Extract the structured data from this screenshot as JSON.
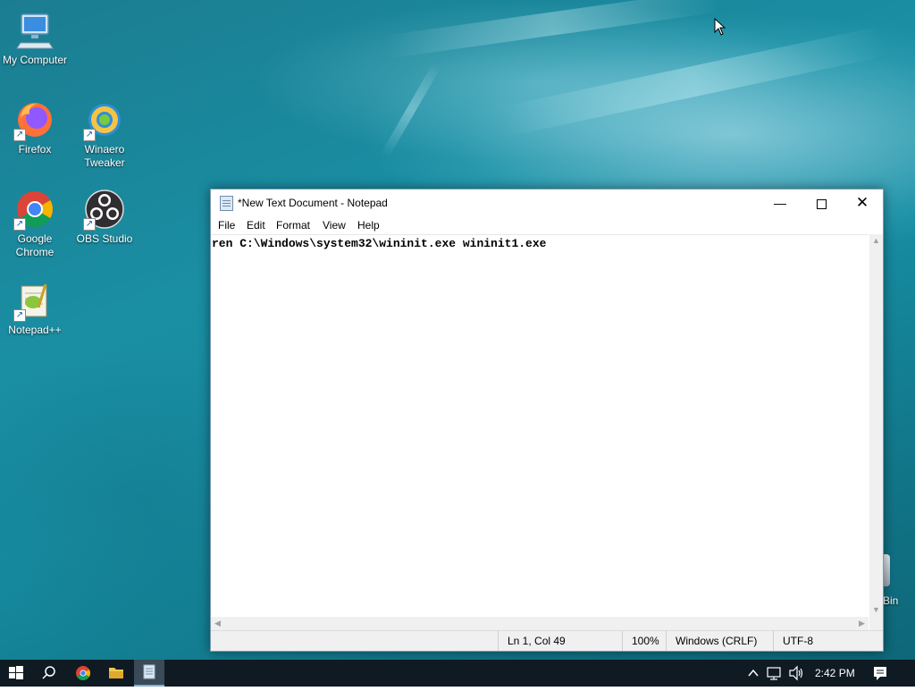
{
  "desktop": {
    "icons": [
      {
        "label": "My Computer",
        "icon": "computer-icon"
      },
      {
        "label": "Firefox",
        "icon": "firefox-icon"
      },
      {
        "label": "Winaero Tweaker",
        "icon": "winaero-tweaker-icon"
      },
      {
        "label": "Google Chrome",
        "icon": "chrome-icon"
      },
      {
        "label": "OBS Studio",
        "icon": "obs-studio-icon"
      },
      {
        "label": "Notepad++",
        "icon": "notepad-plus-plus-icon"
      }
    ],
    "recycle_bin_label_visible": "Bin"
  },
  "window": {
    "title": "*New Text Document - Notepad",
    "menu": [
      "File",
      "Edit",
      "Format",
      "View",
      "Help"
    ],
    "content": "ren C:\\Windows\\system32\\wininit.exe wininit1.exe",
    "status": {
      "position": "Ln 1, Col 49",
      "zoom": "100%",
      "line_endings": "Windows (CRLF)",
      "encoding": "UTF-8"
    }
  },
  "taskbar": {
    "clock": "2:42 PM"
  },
  "colors": {
    "accent": "#1a8ea3",
    "taskbar": "#0f1a22"
  }
}
